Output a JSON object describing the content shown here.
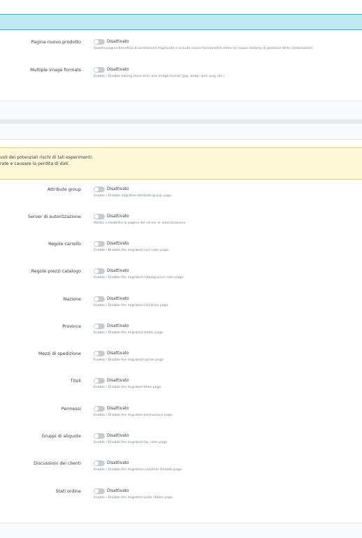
{
  "top_section": {
    "rows": [
      {
        "label": "Pagina nuovo prodotto",
        "state": "Disattivato",
        "help": "Questa pagina beneficia di prestazioni migliorate e include nuove funzionalità come un nuovo sistema di gestione delle combinazioni."
      },
      {
        "label": "Multiple image formats",
        "state": "Disattivato",
        "help": "Enable / Disable having more than one image format (jpg, webp, avif, png, etc.)"
      }
    ]
  },
  "warning": {
    "line1": "voli dei potenziali rischi di tali esperimenti:",
    "line2": "rate e causare la perdita di dati."
  },
  "migrated_pages": {
    "rows": [
      {
        "label": "Attribute group",
        "state": "Disattivato",
        "help": "Enable / Disable migrated attribute group page."
      },
      {
        "label": "Server di autorizzazione",
        "state": "Disattivato",
        "help": "Abilita o disabilita la pagina del server di autorizzazione."
      },
      {
        "label": "Regole carrello",
        "state": "Disattivato",
        "help": "Enable / Disable the migrated cart rules page."
      },
      {
        "label": "Regole prezzi catalogo",
        "state": "Disattivato",
        "help": "Enable / Disable the migrated catalog price rules page."
      },
      {
        "label": "Nazione",
        "state": "Disattivato",
        "help": "Enable / Disable the migrated countries page."
      },
      {
        "label": "Province",
        "state": "Disattivato",
        "help": "Enable / Disable the migrated states page."
      },
      {
        "label": "Mezzi di spedizione",
        "state": "Disattivato",
        "help": "Enable / Disable the migrated carrier page."
      },
      {
        "label": "Titoli",
        "state": "Disattivato",
        "help": "Enable / Disable the migrated titles page."
      },
      {
        "label": "Permessi",
        "state": "Disattivato",
        "help": "Enable / Disable the migrated permissions page."
      },
      {
        "label": "Gruppi di aliquote",
        "state": "Disattivato",
        "help": "Enable / Disable the migrated tax rules page."
      },
      {
        "label": "Discussioni dei clienti",
        "state": "Disattivato",
        "help": "Enable / Disable the migrated customer threads page."
      },
      {
        "label": "Stati ordine",
        "state": "Disattivato",
        "help": "Enable / Disable the migrated order states page."
      }
    ]
  }
}
